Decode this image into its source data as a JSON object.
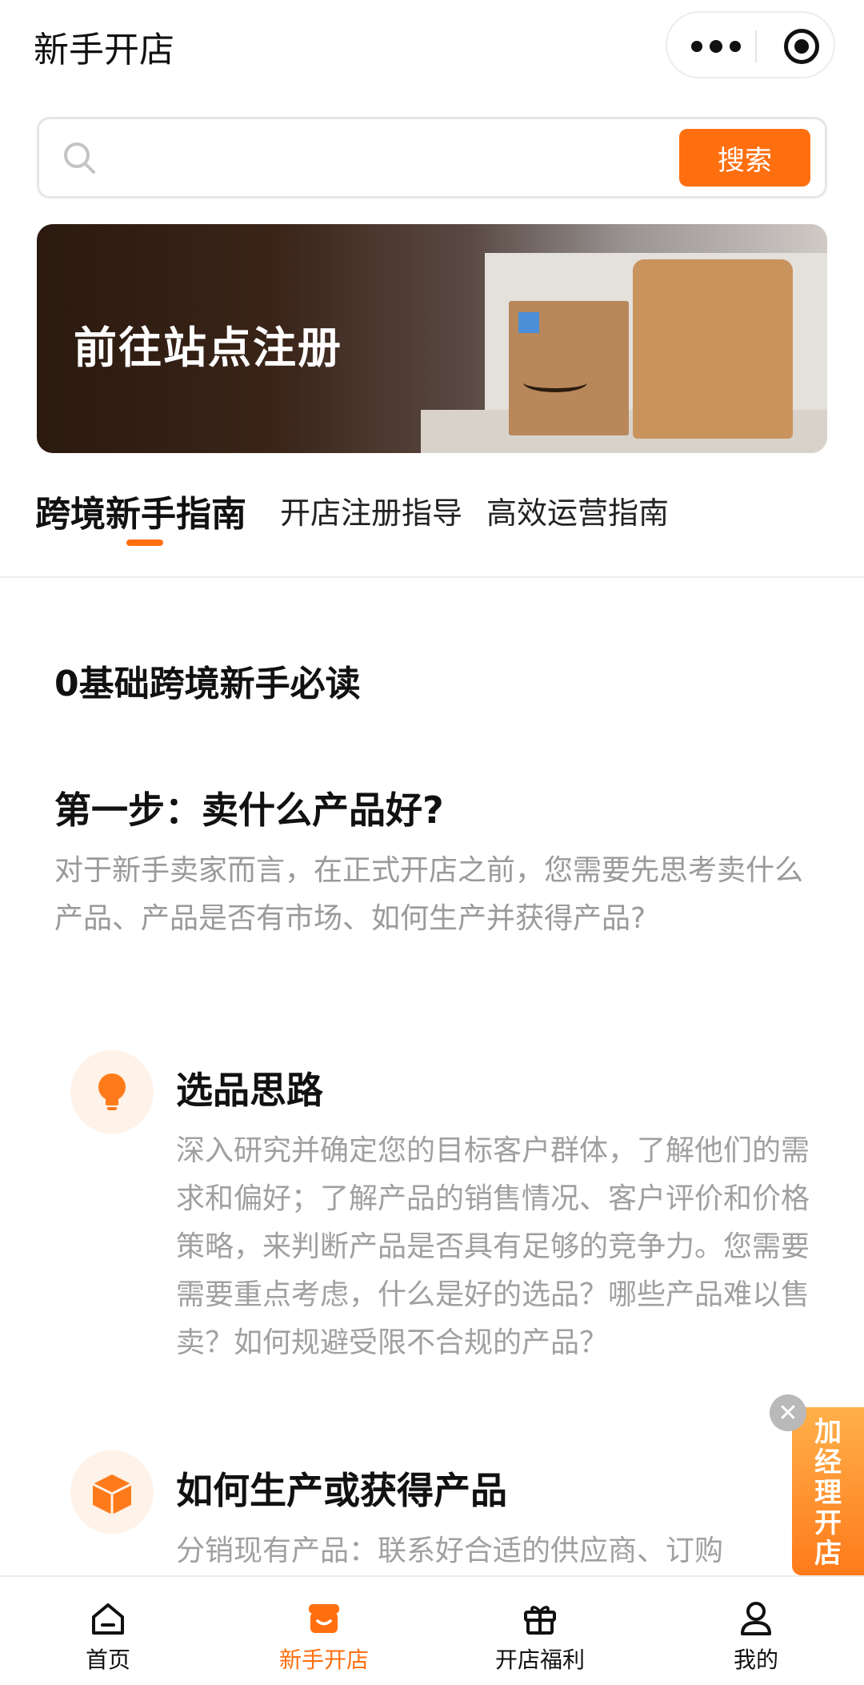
{
  "header": {
    "title": "新手开店"
  },
  "search": {
    "placeholder": "",
    "button_label": "搜索"
  },
  "banner": {
    "label": "前往站点注册"
  },
  "tabs": [
    {
      "label": "跨境新手指南",
      "active": true
    },
    {
      "label": "开店注册指导",
      "active": false
    },
    {
      "label": "高效运营指南",
      "active": false
    }
  ],
  "content": {
    "guide_heading": "0基础跨境新手必读",
    "step_title": "第一步：卖什么产品好?",
    "step_desc": "对于新手卖家而言，在正式开店之前，您需要先思考卖什么产品、产品是否有市场、如何生产并获得产品?",
    "items": [
      {
        "icon": "lightbulb-icon",
        "title": "选品思路",
        "text": "深入研究并确定您的目标客户群体，了解他们的需求和偏好；了解产品的销售情况、客户评价和价格策略，来判断产品是否具有足够的竞争力。您需要需要重点考虑，什么是好的选品？哪些产品难以售卖？如何规避受限不合规的产品？"
      },
      {
        "icon": "package-icon",
        "title": "如何生产或获得产品",
        "text": "分销现有产品：联系好合适的供应商、订购"
      }
    ]
  },
  "float": {
    "label": "加经理开店",
    "close": "✕"
  },
  "bottom_nav": [
    {
      "label": "首页",
      "icon": "home-icon",
      "active": false
    },
    {
      "label": "新手开店",
      "icon": "shop-icon",
      "active": true
    },
    {
      "label": "开店福利",
      "icon": "gift-icon",
      "active": false
    },
    {
      "label": "我的",
      "icon": "profile-icon",
      "active": false
    }
  ],
  "colors": {
    "accent": "#ff6f0f",
    "muted_text": "#9a9a9a",
    "icon_bg": "#fff2e8"
  }
}
